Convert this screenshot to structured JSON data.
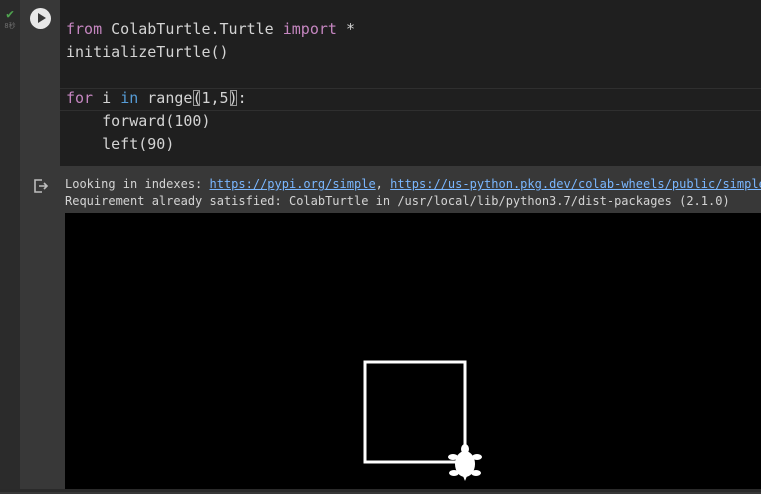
{
  "execution": {
    "status_icon": "check-icon",
    "time": "8秒"
  },
  "cell": {
    "run_icon": "play-icon",
    "code": {
      "line1": {
        "kw_from": "from",
        "module": " ColabTurtle.Turtle ",
        "kw_import": "import",
        "rest": " *"
      },
      "line2": "initializeTurtle()",
      "line4": {
        "kw_for": "for",
        "var": " i ",
        "kw_in": "in",
        "func": " range",
        "lparen": "(",
        "args": "1,5",
        "rparen": ")",
        "colon": ":"
      },
      "line5": "    forward(100)",
      "line6": "    left(90)"
    },
    "colors": {
      "keyword_purple": "#c586c0",
      "keyword_blue": "#569cd6",
      "code_text": "#d4d4d4",
      "editor_bg": "#1f1f1f"
    }
  },
  "output": {
    "icon": "output-redirect-icon",
    "line1_prefix": "Looking in indexes: ",
    "link1": "https://pypi.org/simple",
    "separator": ", ",
    "link2": "https://us-python.pkg.dev/colab-wheels/public/simple/",
    "line2": "Requirement already satisfied: ColabTurtle in /usr/local/lib/python3.7/dist-packages (2.1.0)",
    "canvas": {
      "background": "#000000",
      "pen_color": "#ffffff",
      "turtle_icon": "turtle-icon"
    }
  }
}
